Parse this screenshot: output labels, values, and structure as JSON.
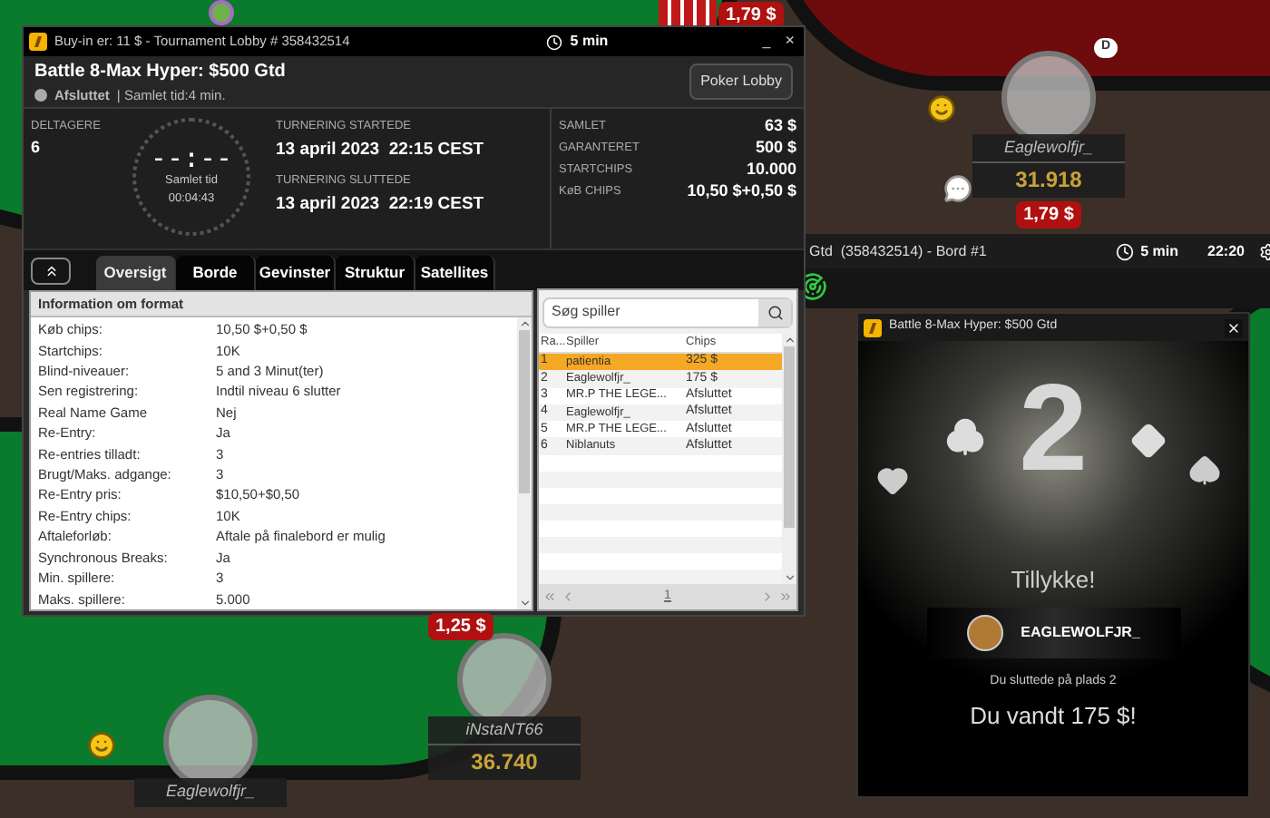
{
  "top_bet": "1,79 $",
  "dealer_button": "D",
  "seats": [
    {
      "name": "Eaglewolfjr_",
      "stack": "31.918",
      "bet": "1,79 $"
    },
    {
      "name": "iNstaNT66",
      "stack": "36.740",
      "bet": "1,25 $"
    },
    {
      "name": "Eaglewolfjr_"
    }
  ],
  "table_window": {
    "title": "Gtd  (358432514) - Bord #1",
    "timer": "5 min",
    "clock": "22:20"
  },
  "lobby": {
    "title": "Buy-in er: 11 $ - Tournament Lobby # 358432514",
    "timer": "5 min",
    "minimize": "_",
    "close": "×",
    "name": "Battle 8-Max Hyper: $500 Gtd",
    "status": "Afsluttet",
    "total_time": "| Samlet tid:4 min.",
    "poker_lobby_button": "Poker Lobby",
    "participants_label": "DELTAGERE",
    "participants": "6",
    "clock_display": "--:--",
    "clock_label": "Samlet tid",
    "clock_value": "00:04:43",
    "started_label": "TURNERING STARTEDE",
    "started": "13 april 2023  22:15 CEST",
    "ended_label": "TURNERING SLUTTEDE",
    "ended": "13 april 2023  22:19 CEST",
    "summary": [
      {
        "label": "SAMLET",
        "value": "63 $"
      },
      {
        "label": "GARANTERET",
        "value": "500 $"
      },
      {
        "label": "STARTCHIPS",
        "value": "10.000"
      },
      {
        "label": "KøB CHIPS",
        "value": "10,50 $+0,50 $"
      }
    ],
    "tabs": [
      {
        "label": "Oversigt",
        "selected": true
      },
      {
        "label": "Borde",
        "selected": false
      },
      {
        "label": "Gevinster",
        "selected": false
      },
      {
        "label": "Struktur",
        "selected": false
      },
      {
        "label": "Satellites",
        "selected": false
      }
    ],
    "format_title": "Information om format",
    "format_rows": [
      {
        "label": "Køb chips:",
        "value": "10,50 $+0,50 $"
      },
      {
        "label": "Startchips:",
        "value": "10K"
      },
      {
        "label": "Blind-niveauer:",
        "value": "5 and 3 Minut(ter)"
      },
      {
        "label": "Sen registrering:",
        "value": "Indtil niveau 6 slutter"
      },
      {
        "label": "Real Name Game",
        "value": "Nej"
      },
      {
        "label": "Re-Entry:",
        "value": "Ja"
      },
      {
        "label": "Re-entries tilladt:",
        "value": "3"
      },
      {
        "label": "Brugt/Maks. adgange:",
        "value": "3"
      },
      {
        "label": "Re-Entry pris:",
        "value": "$10,50+$0,50"
      },
      {
        "label": "Re-Entry chips:",
        "value": "10K"
      },
      {
        "label": "Aftaleforløb:",
        "value": "Aftale på finalebord er mulig"
      },
      {
        "label": "Synchronous Breaks:",
        "value": "Ja"
      },
      {
        "label": "Min. spillere:",
        "value": "3"
      },
      {
        "label": "Maks. spillere:",
        "value": "5.000"
      }
    ],
    "search_placeholder": "Søg spiller",
    "columns": [
      "Ra...",
      "Spiller",
      "Chips"
    ],
    "players": [
      {
        "rank": "1",
        "player": "patientia",
        "chips": "325 $",
        "selected": true
      },
      {
        "rank": "2",
        "player": "Eaglewolfjr_",
        "chips": "175 $",
        "selected": false
      },
      {
        "rank": "3",
        "player": "MR.P THE LEGE...",
        "chips": "Afsluttet",
        "selected": false
      },
      {
        "rank": "4",
        "player": "Eaglewolfjr_",
        "chips": "Afsluttet",
        "selected": false
      },
      {
        "rank": "5",
        "player": "MR.P THE LEGE...",
        "chips": "Afsluttet",
        "selected": false
      },
      {
        "rank": "6",
        "player": "Niblanuts",
        "chips": "Afsluttet",
        "selected": false
      }
    ],
    "page": "1"
  },
  "popup": {
    "title": "Battle 8-Max Hyper: $500 Gtd",
    "place": "2",
    "congrats": "Tillykke!",
    "player": "EAGLEWOLFJR_",
    "finished": "Du sluttede på plads 2",
    "won": "Du vandt 175 $!"
  }
}
